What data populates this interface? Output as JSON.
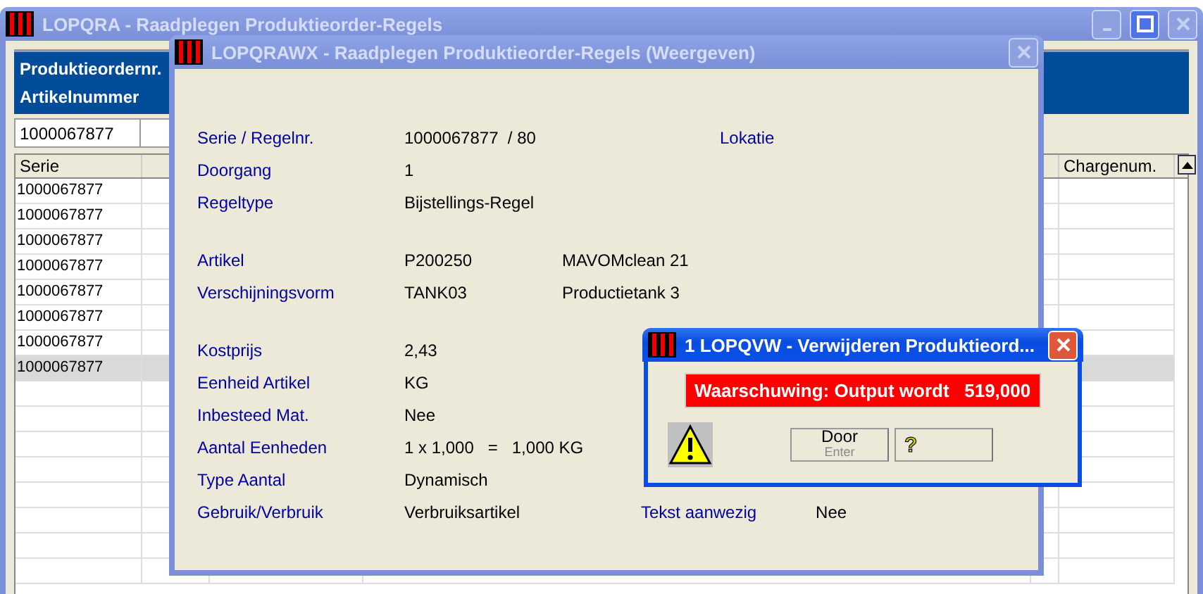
{
  "main_window": {
    "title": "LOPQRA - Raadplegen Produktieorder-Regels",
    "active": false,
    "header": [
      "Produktieordernr.",
      "Artikelnummer"
    ],
    "search": {
      "value": "1000067877"
    },
    "table": {
      "columns": [
        {
          "label": "Serie"
        },
        {
          "label": "Chargenum."
        }
      ],
      "rows": [
        {
          "serie": "1000067877",
          "selected": false
        },
        {
          "serie": "1000067877",
          "selected": false
        },
        {
          "serie": "1000067877",
          "selected": false
        },
        {
          "serie": "1000067877",
          "selected": false
        },
        {
          "serie": "1000067877",
          "selected": false
        },
        {
          "serie": "1000067877",
          "selected": false
        },
        {
          "serie": "1000067877",
          "selected": false
        },
        {
          "serie": "1000067877",
          "selected": true
        }
      ]
    }
  },
  "detail_window": {
    "title": "LOPQRAWX - Raadplegen Produktieorder-Regels (Weergeven)",
    "active": false,
    "sections": [
      [
        {
          "label": "Serie / Regelnr.",
          "value": "1000067877  / 80",
          "side": {
            "label": "Lokatie"
          }
        },
        {
          "label": "Doorgang",
          "value": "1"
        },
        {
          "label": "Regeltype",
          "value": "Bijstellings-Regel"
        }
      ],
      [
        {
          "label": "Artikel",
          "value": "P200250",
          "extra": "MAVOMclean 21"
        },
        {
          "label": "Verschijningsvorm",
          "value": "TANK03",
          "extra": "Productietank 3"
        }
      ],
      [
        {
          "label": "Kostprijs",
          "value": "2,43"
        },
        {
          "label": "Eenheid Artikel",
          "value": "KG"
        },
        {
          "label": "Inbesteed Mat.",
          "value": "Nee"
        },
        {
          "label": "Aantal Eenheden",
          "value": "1 x 1,000   =   1,000 KG"
        },
        {
          "label": "Type Aantal",
          "value": "Dynamisch"
        },
        {
          "label": "Gebruik/Verbruik",
          "value": "Verbruiksartikel",
          "side": {
            "label": "Tekst aanwezig",
            "value": "Nee"
          }
        }
      ]
    ]
  },
  "message_window": {
    "title": "1 LOPQVW - Verwijderen Produktieord...",
    "active": true,
    "warning": "Waarschuwing: Output wordt   519,000",
    "buttons": [
      {
        "kind": "text",
        "label": "Door",
        "shortcut": "Enter"
      },
      {
        "kind": "help",
        "label": "?"
      }
    ]
  }
}
